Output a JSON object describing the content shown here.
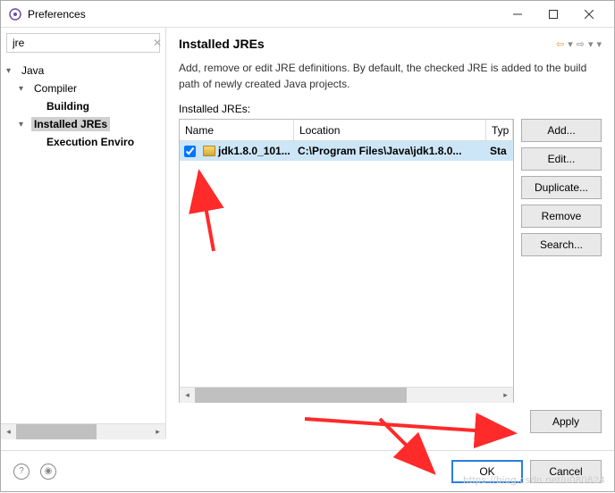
{
  "window": {
    "title": "Preferences"
  },
  "filter": {
    "value": "jre"
  },
  "tree": {
    "items": [
      {
        "label": "Java",
        "level": 0,
        "expanded": true,
        "bold": false,
        "selected": false
      },
      {
        "label": "Compiler",
        "level": 1,
        "expanded": true,
        "bold": false,
        "selected": false
      },
      {
        "label": "Building",
        "level": 2,
        "expanded": false,
        "bold": true,
        "selected": false
      },
      {
        "label": "Installed JREs",
        "level": 1,
        "expanded": true,
        "bold": true,
        "selected": true
      },
      {
        "label": "Execution Enviro",
        "level": 2,
        "expanded": false,
        "bold": true,
        "selected": false
      }
    ]
  },
  "page": {
    "title": "Installed JREs",
    "desc": "Add, remove or edit JRE definitions. By default, the checked JRE is added to the build path of newly created Java projects.",
    "table_label": "Installed JREs:",
    "columns": {
      "name": "Name",
      "location": "Location",
      "type": "Typ"
    },
    "rows": [
      {
        "checked": true,
        "name": "jdk1.8.0_101...",
        "location": "C:\\Program Files\\Java\\jdk1.8.0...",
        "type": "Sta"
      }
    ],
    "buttons": {
      "add": "Add...",
      "edit": "Edit...",
      "duplicate": "Duplicate...",
      "remove": "Remove",
      "search": "Search..."
    },
    "apply": "Apply"
  },
  "footer": {
    "ok": "OK",
    "cancel": "Cancel"
  },
  "watermark": "https://biog.csdn.net/u080624"
}
